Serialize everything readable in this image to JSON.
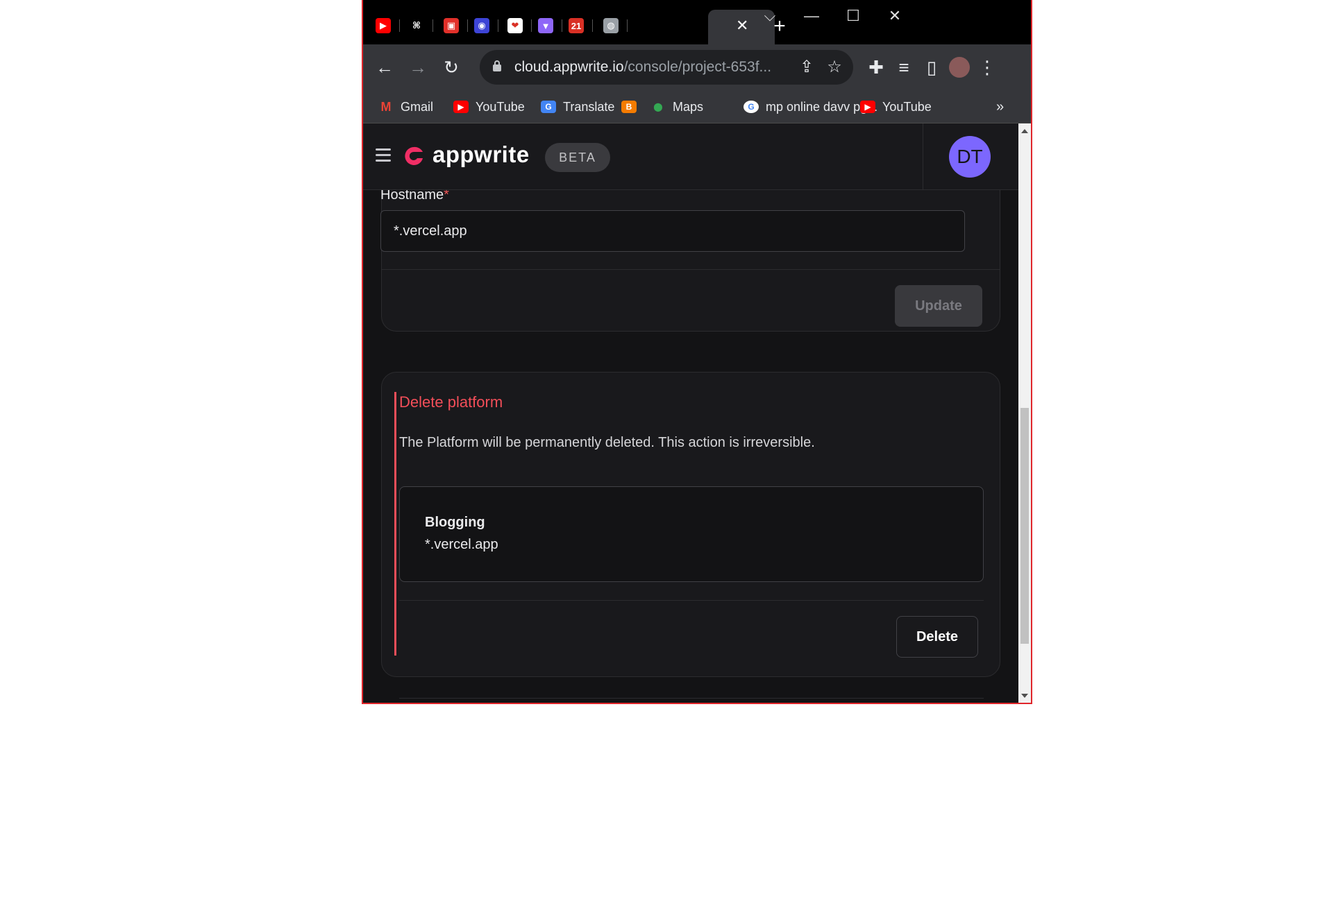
{
  "browser": {
    "tabs": [
      {
        "icon": "youtube-icon",
        "color": "#ff0000",
        "label": "▶"
      },
      {
        "icon": "github-icon",
        "color": "#000000",
        "label": "⌘"
      },
      {
        "icon": "youtube-icon",
        "color": "#e1302a",
        "label": "▣"
      },
      {
        "icon": "avatar-icon",
        "color": "#3d44d6",
        "label": "◉"
      },
      {
        "icon": "chat-icon",
        "color": "#ffffff",
        "label": "❤"
      },
      {
        "icon": "vite-icon",
        "color": "#8e66f8",
        "label": "▼"
      },
      {
        "icon": "calendar-icon",
        "color": "#d93025",
        "label": "21"
      },
      {
        "icon": "globe-icon",
        "color": "#9aa0a6",
        "label": "◍"
      }
    ],
    "new_tab": "+",
    "window_controls": {
      "tab_search": "⌵",
      "minimize": "—",
      "maximize": "☐",
      "close": "✕"
    },
    "url_host": "cloud.appwrite.io",
    "url_path": "/console/project-653f...",
    "bookmarks": [
      {
        "label": "Gmail",
        "icon": "gmail-icon",
        "color": "#ea4335",
        "glyph": "M"
      },
      {
        "label": "YouTube",
        "icon": "youtube-icon",
        "color": "#ff0000",
        "glyph": "▶"
      },
      {
        "label": "Translate",
        "icon": "translate-icon",
        "color": "#4285f4",
        "glyph": "G"
      },
      {
        "label": "",
        "icon": "blogger-icon",
        "color": "#f57c00",
        "glyph": "B"
      },
      {
        "label": "Maps",
        "icon": "maps-icon",
        "color": "#34a853",
        "glyph": "⬤"
      },
      {
        "label": "mp online davv pg...",
        "icon": "google-icon",
        "color": "#ffffff",
        "glyph": "G"
      },
      {
        "label": "YouTube",
        "icon": "youtube-icon",
        "color": "#ff0000",
        "glyph": "▶"
      }
    ],
    "bookmarks_more": "»"
  },
  "app": {
    "brand": "appwrite",
    "badge": "BETA",
    "avatar_initials": "DT"
  },
  "hostname_card": {
    "label": "Hostname",
    "required_mark": "*",
    "value": "*.vercel.app",
    "update_label": "Update"
  },
  "delete_card": {
    "title": "Delete platform",
    "description": "The Platform will be permanently deleted. This action is irreversible.",
    "platform_name": "Blogging",
    "platform_host": "*.vercel.app",
    "delete_label": "Delete"
  },
  "colors": {
    "accent": "#f02e65",
    "danger": "#f24e59",
    "avatar": "#7c67fe"
  }
}
